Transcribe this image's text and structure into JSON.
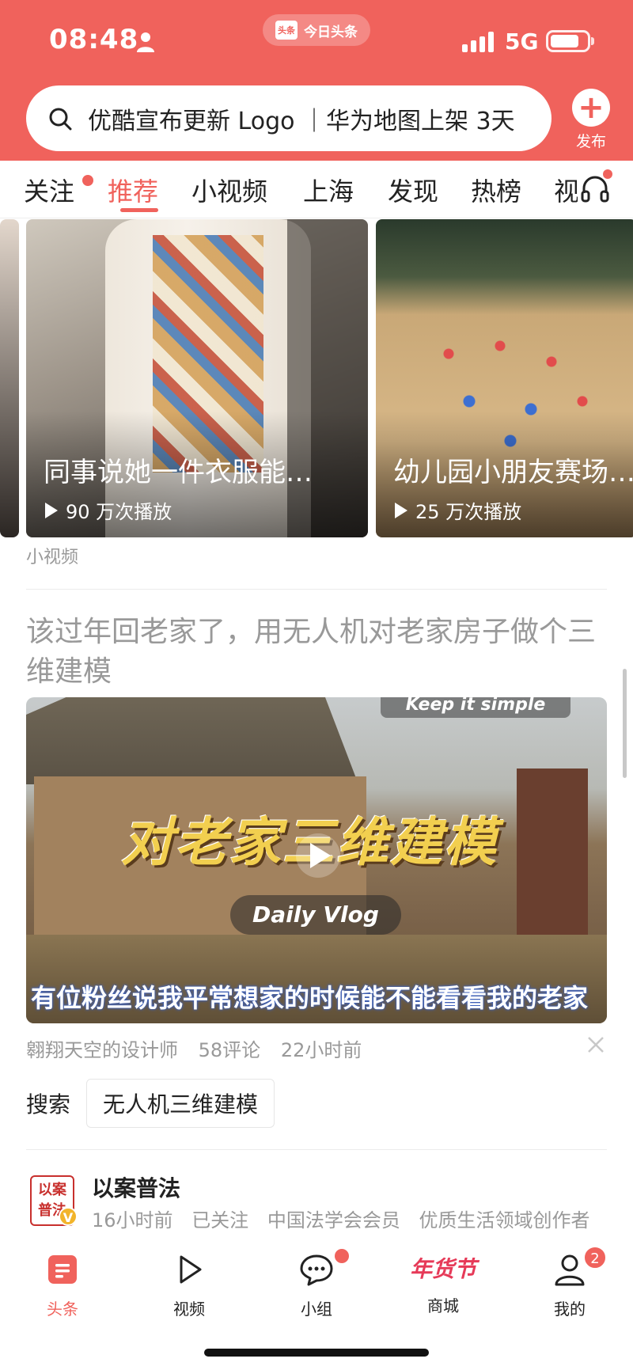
{
  "status_bar": {
    "time": "08:48",
    "app_badge": "今日头条",
    "app_logo_text": "头条",
    "network": "5G"
  },
  "search": {
    "query": "优酷宣布更新 Logo ｜华为地图上架 3天"
  },
  "publish": {
    "label": "发布"
  },
  "tabs": [
    {
      "label": "关注",
      "dot": true
    },
    {
      "label": "推荐",
      "active": true
    },
    {
      "label": "小视频"
    },
    {
      "label": "上海"
    },
    {
      "label": "发现"
    },
    {
      "label": "热榜"
    },
    {
      "label": "视"
    }
  ],
  "short_videos": [
    {
      "title": "同事说她一件衣服能…",
      "plays": "90 万次播放"
    },
    {
      "title": "幼儿园小朋友赛场…",
      "plays": "25 万次播放"
    }
  ],
  "section_tag": "小视频",
  "article": {
    "title": "该过年回老家了，用无人机对老家房子做个三维建模",
    "video": {
      "overlay_top": "Keep it simple",
      "big_text": "对老家三维建模",
      "vlog_label": "Daily Vlog",
      "caption": "有位粉丝说我平常想家的时候能不能看看我的老家"
    },
    "author": "翱翔天空的设计师",
    "comments": "58评论",
    "time": "22小时前"
  },
  "related_search": {
    "label": "搜索",
    "term": "无人机三维建模"
  },
  "next_author": {
    "name": "以案普法",
    "avatar_text": "以案普法",
    "time": "16小时前",
    "follow": "已关注",
    "badge1": "中国法学会会员",
    "badge2": "优质生活领域创作者"
  },
  "bottom_nav": [
    {
      "label": "头条",
      "icon": "headline-icon",
      "active": true
    },
    {
      "label": "视频",
      "icon": "video-icon"
    },
    {
      "label": "小组",
      "icon": "chat-icon",
      "dot": true
    },
    {
      "label": "商城",
      "icon": "nianhuojie-icon",
      "art_text": "年货节"
    },
    {
      "label": "我的",
      "icon": "user-icon",
      "badge": "2"
    }
  ],
  "colors": {
    "brand": "#f0625c",
    "muted": "#999999"
  }
}
